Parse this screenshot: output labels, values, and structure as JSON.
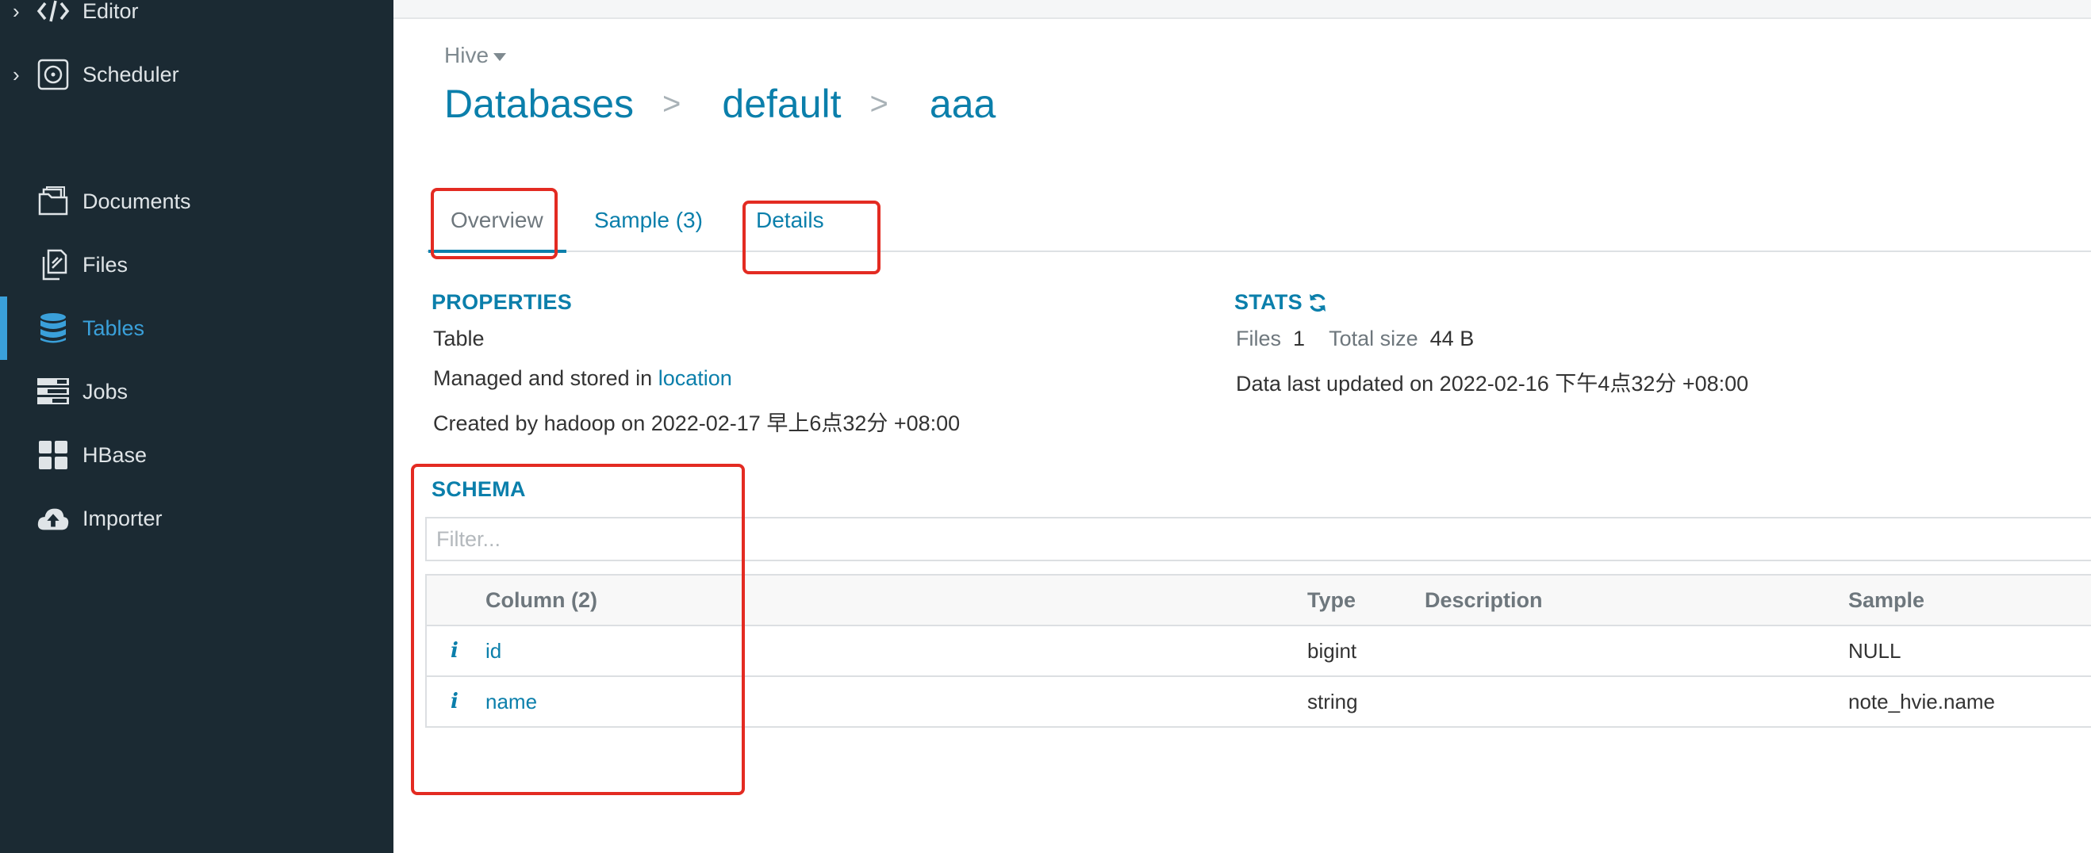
{
  "sidebar": {
    "items": [
      {
        "label": "Editor",
        "icon": "code-icon",
        "expandable": true
      },
      {
        "label": "Scheduler",
        "icon": "scheduler-icon",
        "expandable": true
      },
      {
        "label": "Documents",
        "icon": "documents-icon"
      },
      {
        "label": "Files",
        "icon": "files-icon"
      },
      {
        "label": "Tables",
        "icon": "database-icon",
        "active": true
      },
      {
        "label": "Jobs",
        "icon": "jobs-icon"
      },
      {
        "label": "HBase",
        "icon": "grid-icon"
      },
      {
        "label": "Importer",
        "icon": "cloud-upload-icon"
      }
    ]
  },
  "header": {
    "source": "Hive",
    "breadcrumb": {
      "root": "Databases",
      "separator": ">",
      "database": "default",
      "table": "aaa"
    }
  },
  "tabs": [
    {
      "label": "Overview",
      "active": true
    },
    {
      "label": "Sample (3)"
    },
    {
      "label": "Details"
    }
  ],
  "properties": {
    "title": "PROPERTIES",
    "type": "Table",
    "managed_prefix": "Managed and stored in ",
    "location_link": "location",
    "created": "Created by hadoop on 2022-02-17 早上6点32分 +08:00"
  },
  "stats": {
    "title": "STATS",
    "files_label": "Files",
    "files_value": "1",
    "size_label": "Total size",
    "size_value": "44 B",
    "last_updated": "Data last updated on 2022-02-16 下午4点32分 +08:00"
  },
  "schema": {
    "title": "SCHEMA",
    "filter_placeholder": "Filter...",
    "headers": {
      "column": "Column (2)",
      "type": "Type",
      "description": "Description",
      "sample": "Sample"
    },
    "rows": [
      {
        "name": "id",
        "type": "bigint",
        "description": "",
        "sample": "NULL"
      },
      {
        "name": "name",
        "type": "string",
        "description": "",
        "sample": "note_hvie.name"
      }
    ]
  },
  "colors": {
    "sidebar_bg": "#1b2a33",
    "accent": "#0b7fab",
    "sidebar_active": "#3aa0da",
    "annotation_red": "#e32b22"
  }
}
